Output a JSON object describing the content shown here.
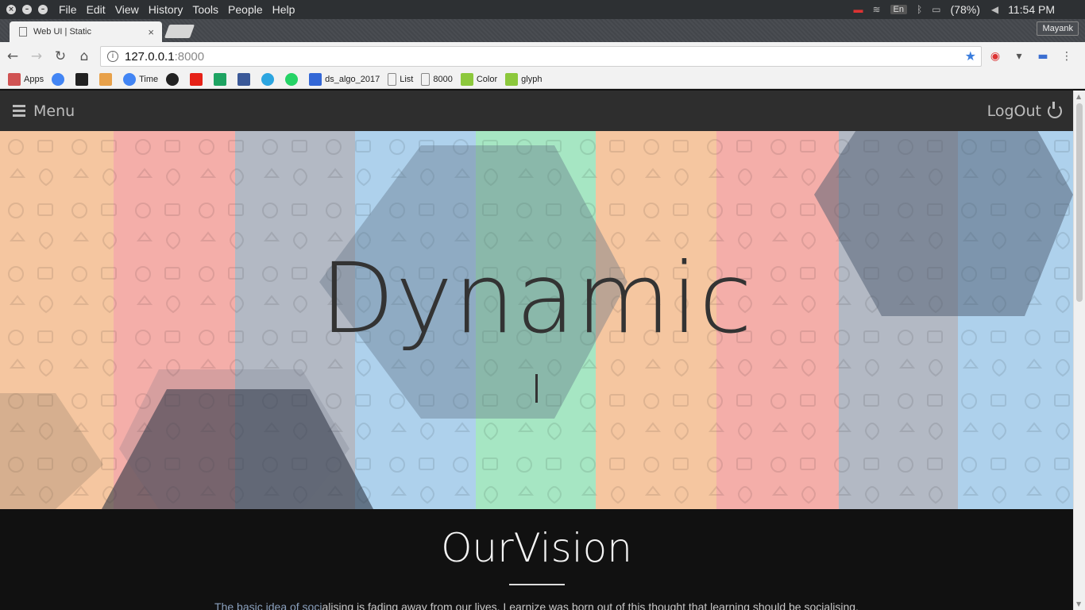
{
  "system_bar": {
    "menus": [
      "File",
      "Edit",
      "View",
      "History",
      "Tools",
      "People",
      "Help"
    ],
    "language": "En",
    "battery": "(78%)",
    "time": "11:54 PM"
  },
  "browser": {
    "tab_title": "Web UI | Static",
    "tab_close": "×",
    "profile": "Mayank",
    "url_host": "127.0.0.1",
    "url_port": ":8000",
    "bookmarks": [
      {
        "label": "Apps",
        "color": "#d05353"
      },
      {
        "label": "",
        "color": "#4285f4"
      },
      {
        "label": "",
        "color": "#222222"
      },
      {
        "label": "",
        "color": "#e8a14a"
      },
      {
        "label": "Time",
        "color": "#4285f4"
      },
      {
        "label": "",
        "color": "#222222"
      },
      {
        "label": "",
        "color": "#e62117"
      },
      {
        "label": "",
        "color": "#1ea362"
      },
      {
        "label": "",
        "color": "#3b5998"
      },
      {
        "label": "",
        "color": "#2ca5e0"
      },
      {
        "label": "",
        "color": "#25d366"
      },
      {
        "label": "ds_algo_2017",
        "color": "#3367d6"
      },
      {
        "label": "List",
        "color": "#888888"
      },
      {
        "label": "8000",
        "color": "#888888"
      },
      {
        "label": "Color",
        "color": "#8cc83c"
      },
      {
        "label": "glyph",
        "color": "#8cc83c"
      }
    ]
  },
  "app": {
    "menu_label": "Menu",
    "logout_label": "LogOut",
    "hero_title": "Dynamic",
    "stripe_colors": [
      "#f5c6a0",
      "#f4aea9",
      "#b3b9c4",
      "#aed1ec",
      "#a6e6c3",
      "#f5c6a0",
      "#f4aea9",
      "#b3b9c4",
      "#aed1ec"
    ],
    "vision_title": "OurVision",
    "vision_text_highlight": "The basic idea of soci",
    "vision_text_rest": "alising is fading away from our lives. Learnize was born out of this thought that learning should be socialising."
  }
}
